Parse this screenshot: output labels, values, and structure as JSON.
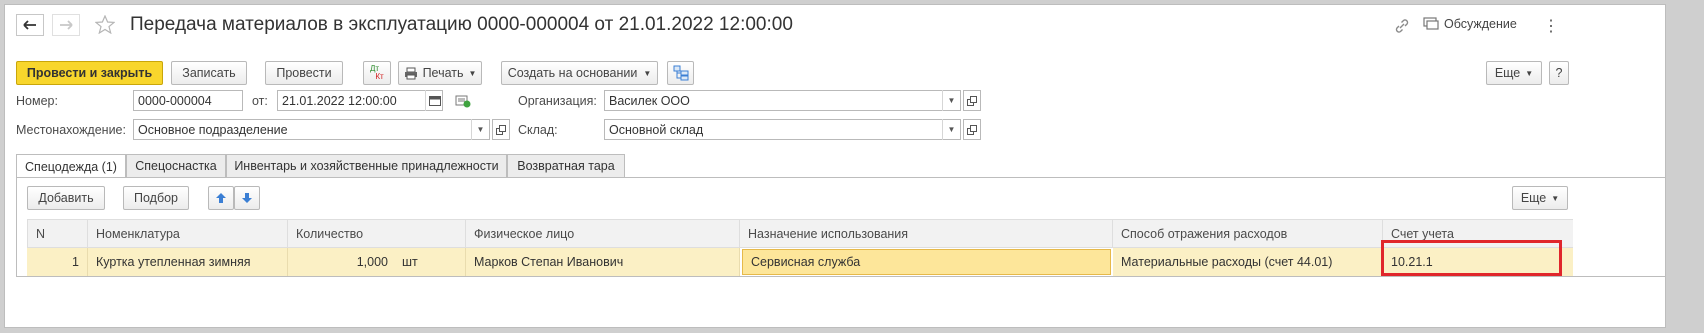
{
  "window": {
    "title": "Передача материалов в эксплуатацию 0000-000004 от 21.01.2022 12:00:00",
    "discussion_label": "Обсуждение",
    "menu_glyph": "⋮"
  },
  "toolbar": {
    "post_close_label": "Провести и закрыть",
    "save_label": "Записать",
    "post_label": "Провести",
    "dtkt_label_dt": "Дт",
    "dtkt_label_kt": "Кт",
    "print_label": "Печать",
    "create_based_label": "Создать на основании",
    "more_label": "Еще",
    "help_label": "?"
  },
  "form": {
    "number_label": "Номер:",
    "number_value": "0000-000004",
    "date_label": "от:",
    "date_value": "21.01.2022 12:00:00",
    "org_label": "Организация:",
    "org_value": "Василек ООО",
    "location_label": "Местонахождение:",
    "location_value": "Основное подразделение",
    "warehouse_label": "Склад:",
    "warehouse_value": "Основной склад"
  },
  "tabs": [
    {
      "label": "Спецодежда (1)",
      "active": true
    },
    {
      "label": "Спецоснастка",
      "active": false
    },
    {
      "label": "Инвентарь и хозяйственные принадлежности",
      "active": false
    },
    {
      "label": "Возвратная тара",
      "active": false
    }
  ],
  "table_toolbar": {
    "add_label": "Добавить",
    "pick_label": "Подбор",
    "more_label": "Еще"
  },
  "table": {
    "columns": [
      "N",
      "Номенклатура",
      "Количество",
      "Физическое лицо",
      "Назначение использования",
      "Способ отражения расходов",
      "Счет учета"
    ],
    "rows": [
      {
        "n": "1",
        "item": "Куртка утепленная зимняя",
        "qty": "1,000",
        "unit": "шт",
        "person": "Марков Степан Иванович",
        "purpose": "Сервисная служба",
        "expense": "Материальные расходы (счет 44.01)",
        "account": "10.21.1"
      }
    ]
  },
  "colors": {
    "primary_button": "#f8d62c",
    "row_selected": "#fbf0c5",
    "active_cell": "#fde69a",
    "highlight_box": "#e0262b",
    "arrow_blue": "#3b7fd4"
  }
}
